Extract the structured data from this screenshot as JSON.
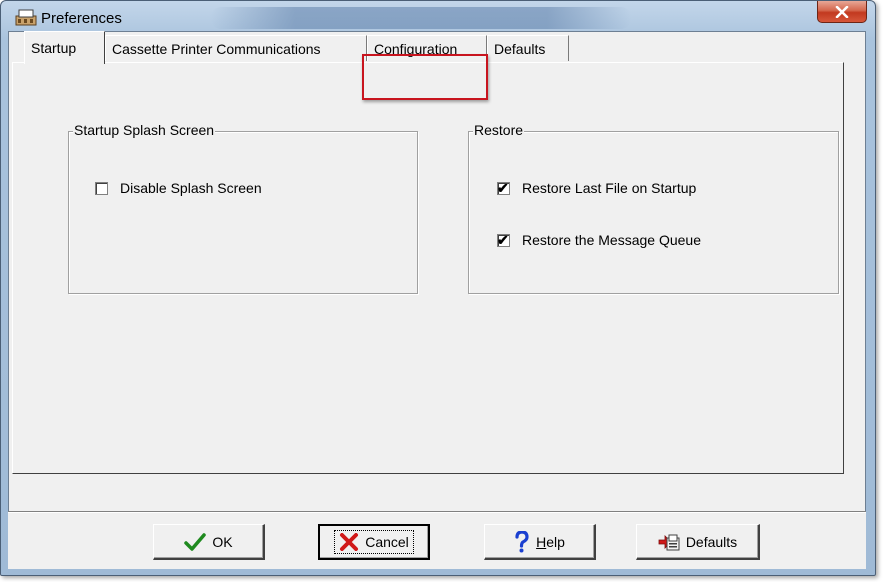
{
  "window": {
    "title": "Preferences",
    "close_label": "x"
  },
  "tabs": [
    {
      "label": "Startup",
      "active": true
    },
    {
      "label": "Cassette Printer Communications",
      "active": false
    },
    {
      "label": "Configuration",
      "active": false,
      "highlighted": true
    },
    {
      "label": "Defaults",
      "active": false
    }
  ],
  "groups": {
    "splash": {
      "title": "Startup Splash Screen",
      "options": [
        {
          "label": "Disable Splash Screen",
          "checked": false
        }
      ]
    },
    "restore": {
      "title": "Restore",
      "options": [
        {
          "label": "Restore Last File on Startup",
          "checked": true
        },
        {
          "label": "Restore the Message Queue",
          "checked": true
        }
      ]
    }
  },
  "buttons": {
    "ok": {
      "label": "OK",
      "icon": "checkmark-icon"
    },
    "cancel": {
      "label": "Cancel",
      "icon": "red-x-icon"
    },
    "help": {
      "label_prefix": "H",
      "label_rest": "elp",
      "icon": "question-mark-icon"
    },
    "defaults": {
      "label": "Defaults",
      "icon": "defaults-icon"
    }
  },
  "colors": {
    "highlight_box": "#c8141e",
    "checkmark_green": "#1f8a1f",
    "cancel_red": "#d01818",
    "help_blue": "#1a3fd0"
  },
  "check_glyph": "✔"
}
